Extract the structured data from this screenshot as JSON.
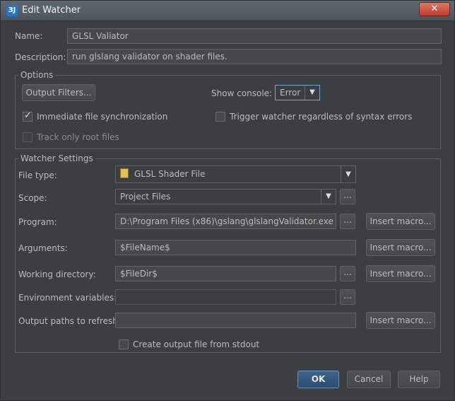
{
  "window": {
    "title": "Edit Watcher",
    "close_symbol": "✕",
    "app_icon": "ЗJ"
  },
  "fields": {
    "name_label": "Name:",
    "name_value": "GLSL Valiator",
    "description_label": "Description:",
    "description_value": "run glslang validator on shader files."
  },
  "options": {
    "group_label": "Options",
    "output_filters_button": "Output Filters...",
    "show_console_label": "Show console:",
    "show_console_value": "Error",
    "immediate_sync_label": "Immediate file synchronization",
    "immediate_sync_checked": true,
    "trigger_label": "Trigger watcher regardless of syntax errors",
    "trigger_checked": false,
    "track_root_label": "Track only root files",
    "track_root_checked": false
  },
  "watcher": {
    "group_label": "Watcher Settings",
    "file_type_label": "File type:",
    "file_type_value": "GLSL Shader File",
    "scope_label": "Scope:",
    "scope_value": "Project Files",
    "program_label": "Program:",
    "program_value": "D:\\Program Files (x86)\\gslang\\glslangValidator.exe",
    "arguments_label": "Arguments:",
    "arguments_value": "$FileName$",
    "working_dir_label": "Working directory:",
    "working_dir_value": "$FileDir$",
    "env_label": "Environment variables:",
    "env_value": "",
    "output_paths_label": "Output paths to refresh:",
    "output_paths_value": "",
    "insert_macro": "Insert macro...",
    "ellipsis": "...",
    "create_output_label": "Create output file from stdout",
    "create_output_checked": false
  },
  "buttons": {
    "ok": "OK",
    "cancel": "Cancel",
    "help": "Help"
  },
  "icons": {
    "dropdown_arrow": "▼",
    "checkmark": "✓"
  }
}
